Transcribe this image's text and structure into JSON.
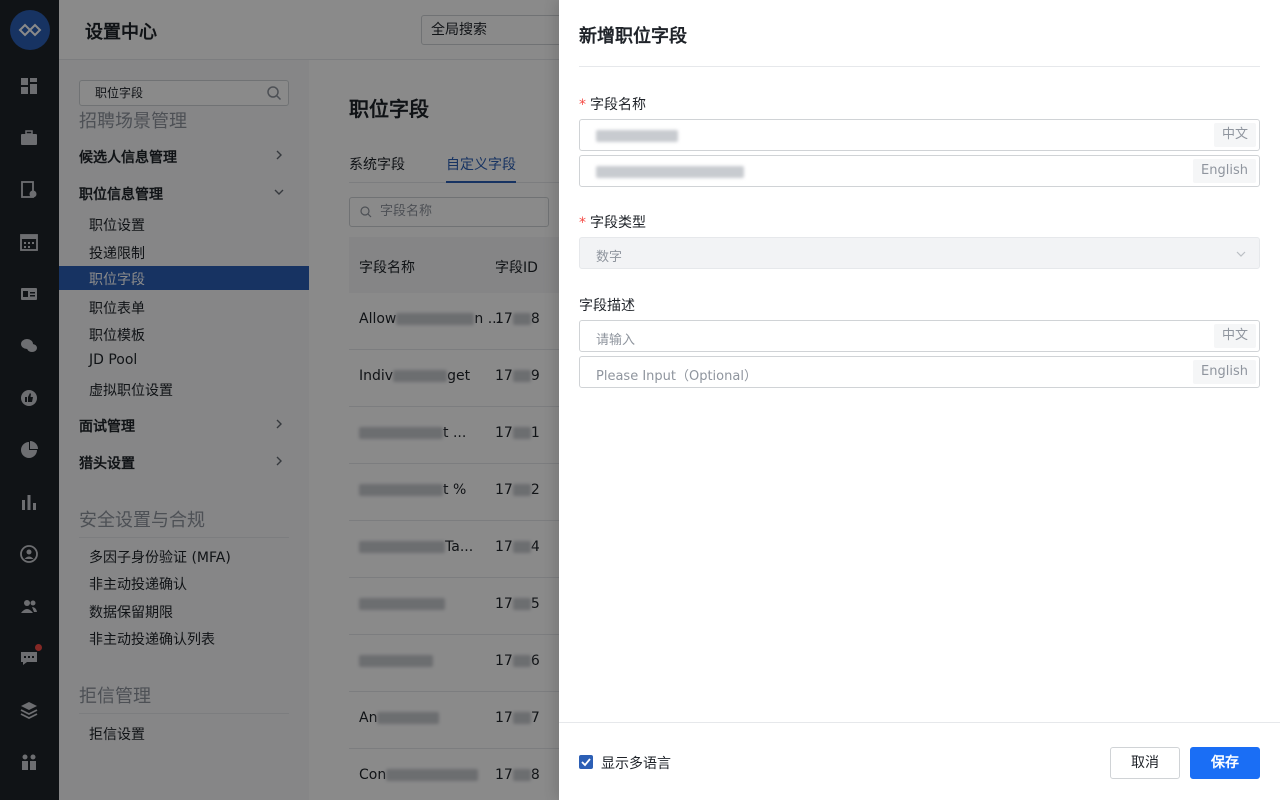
{
  "header": {
    "title": "设置中心",
    "global_search_placeholder": "全局搜索"
  },
  "sidebar": {
    "search_value": "职位字段",
    "groups": [
      {
        "label": "招聘场景管理"
      },
      {
        "label": "安全设置与合规"
      },
      {
        "label": "拒信管理"
      }
    ],
    "categories": [
      {
        "label": "候选人信息管理"
      },
      {
        "label": "职位信息管理"
      },
      {
        "label": "面试管理"
      },
      {
        "label": "猎头设置"
      }
    ],
    "position_items": [
      "职位设置",
      "投递限制",
      "职位字段",
      "职位表单",
      "职位模板",
      "JD Pool",
      "虚拟职位设置"
    ],
    "security_items": [
      "多因子身份验证 (MFA)",
      "非主动投递确认",
      "数据保留期限",
      "非主动投递确认列表"
    ],
    "rejection_items": [
      "拒信设置"
    ]
  },
  "main": {
    "title": "职位字段",
    "tabs": [
      {
        "label": "系统字段"
      },
      {
        "label": "自定义字段"
      }
    ],
    "field_search_placeholder": "字段名称",
    "columns": [
      "字段名称",
      "字段ID"
    ],
    "rows": [
      {
        "name_start": "Allow",
        "name_end": "n ...",
        "id_start": "17",
        "id_end": "8"
      },
      {
        "name_start": "Indiv",
        "name_end": "get",
        "id_start": "17",
        "id_end": "9"
      },
      {
        "name_start": "",
        "name_end": "t ...",
        "id_start": "17",
        "id_end": "1"
      },
      {
        "name_start": "",
        "name_end": "t %",
        "id_start": "17",
        "id_end": "2"
      },
      {
        "name_start": "",
        "name_end": "Ta...",
        "id_start": "17",
        "id_end": "4"
      },
      {
        "name_start": "",
        "name_end": "",
        "id_start": "17",
        "id_end": "5"
      },
      {
        "name_start": "",
        "name_end": "",
        "id_start": "17",
        "id_end": "6"
      },
      {
        "name_start": "An",
        "name_end": "",
        "id_start": "17",
        "id_end": "7"
      },
      {
        "name_start": "Con",
        "name_end": "",
        "id_start": "17",
        "id_end": "8"
      }
    ]
  },
  "drawer": {
    "title": "新增职位字段",
    "field_name_label": "字段名称",
    "field_type_label": "字段类型",
    "field_type_value": "数字",
    "field_desc_label": "字段描述",
    "desc_zh_placeholder": "请输入",
    "desc_en_placeholder": "Please Input（Optional）",
    "suffix_zh": "中文",
    "suffix_en": "English",
    "show_multilang_label": "显示多语言",
    "cancel_label": "取消",
    "save_label": "保存"
  },
  "colors": {
    "accent": "#2c5fb5",
    "primary_button": "#1a6ef5",
    "required": "#f54a45"
  }
}
